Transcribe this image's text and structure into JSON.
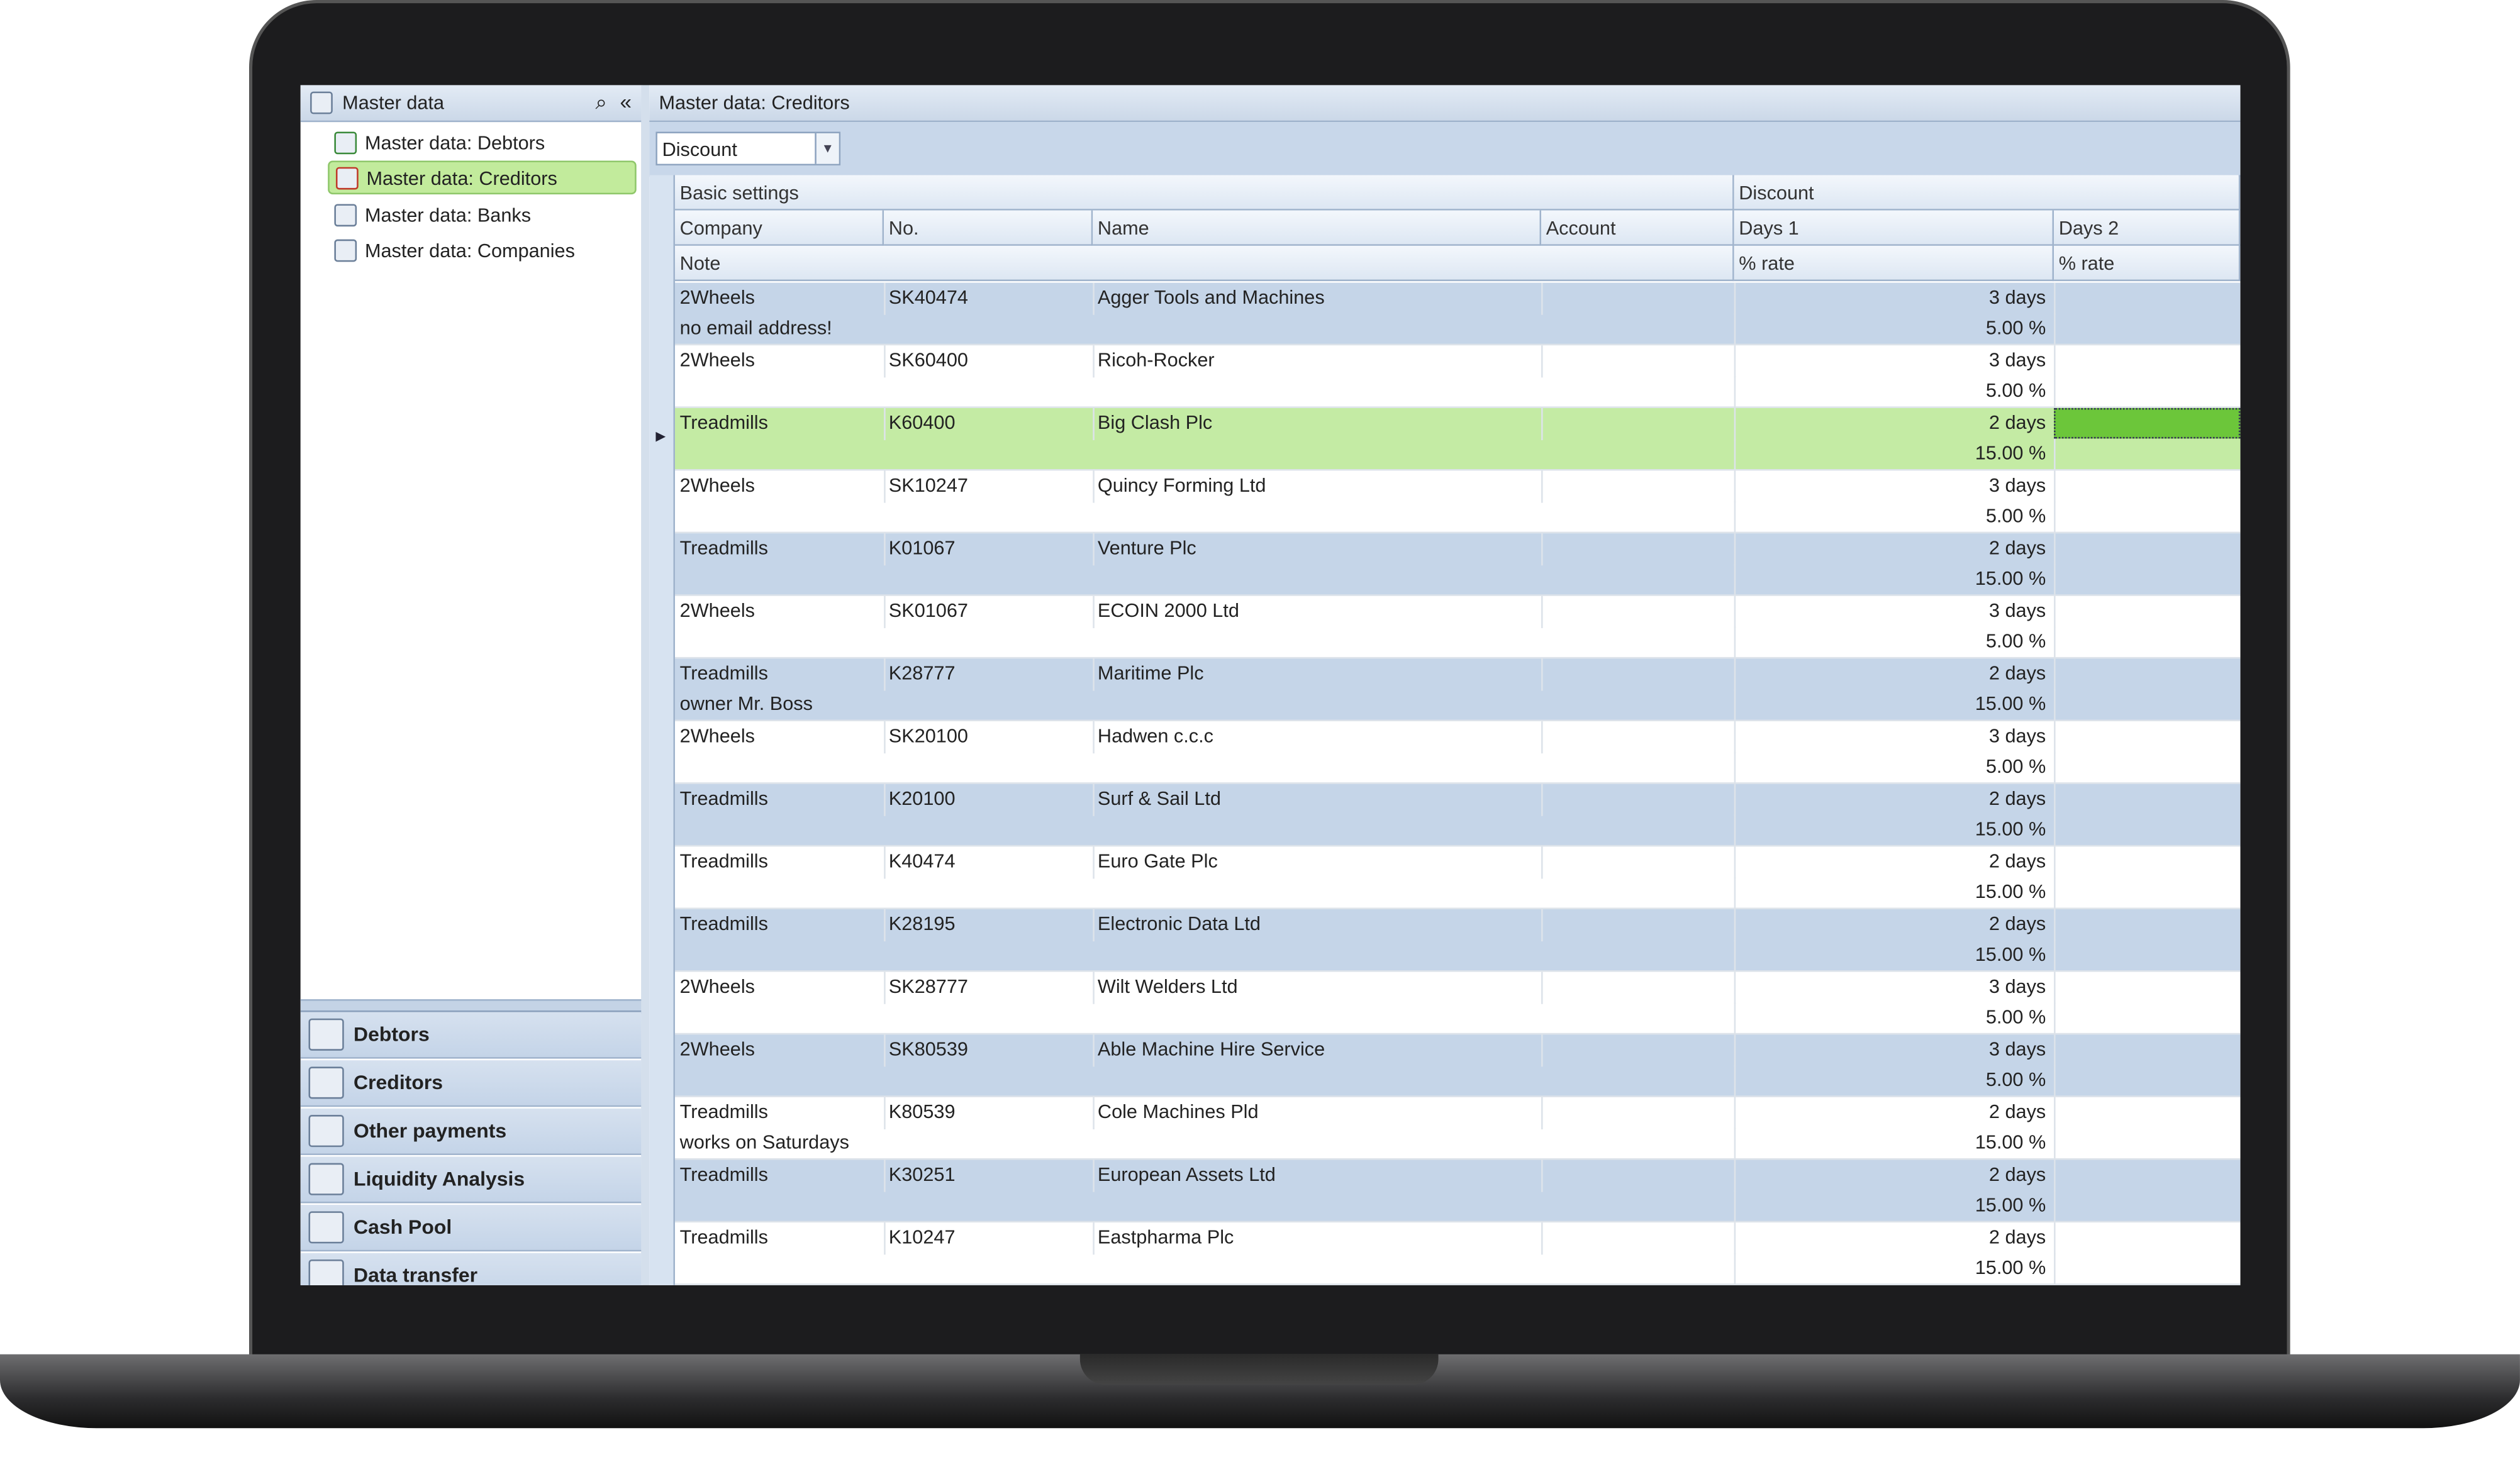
{
  "navigator": {
    "title": "Master data",
    "search_icon": "search-icon",
    "collapse_icon": "double-chevron-left-icon",
    "items": [
      {
        "label": "Master data: Debtors",
        "selected": false
      },
      {
        "label": "Master data: Creditors",
        "selected": true
      },
      {
        "label": "Master data: Banks",
        "selected": false
      },
      {
        "label": "Master data: Companies",
        "selected": false
      }
    ],
    "modules": [
      {
        "label": "Debtors"
      },
      {
        "label": "Creditors"
      },
      {
        "label": "Other payments"
      },
      {
        "label": "Liquidity Analysis"
      },
      {
        "label": "Cash Pool"
      },
      {
        "label": "Data transfer"
      }
    ]
  },
  "main": {
    "title": "Master data: Creditors",
    "view_select": {
      "value": "Discount"
    },
    "bands": {
      "basic": "Basic settings",
      "discount": "Discount"
    },
    "columns": {
      "company": "Company",
      "no": "No.",
      "name": "Name",
      "account": "Account",
      "days1": "Days 1",
      "days2": "Days 2",
      "note": "Note",
      "rate1": "% rate",
      "rate2": "% rate"
    },
    "rows": [
      {
        "company": "2Wheels",
        "no": "SK40474",
        "name": "Agger Tools and Machines",
        "note": "no email address!",
        "days1": "3 days",
        "rate1": "5.00 %"
      },
      {
        "company": "2Wheels",
        "no": "SK60400",
        "name": "Ricoh-Rocker",
        "note": "",
        "days1": "3 days",
        "rate1": "5.00 %"
      },
      {
        "company": "Treadmills",
        "no": "K60400",
        "name": "Big Clash Plc",
        "note": "",
        "days1": "2 days",
        "rate1": "15.00 %",
        "selected": true
      },
      {
        "company": "2Wheels",
        "no": "SK10247",
        "name": "Quincy Forming Ltd",
        "note": "",
        "days1": "3 days",
        "rate1": "5.00 %"
      },
      {
        "company": "Treadmills",
        "no": "K01067",
        "name": "Venture Plc",
        "note": "",
        "days1": "2 days",
        "rate1": "15.00 %"
      },
      {
        "company": "2Wheels",
        "no": "SK01067",
        "name": "ECOIN 2000 Ltd",
        "note": "",
        "days1": "3 days",
        "rate1": "5.00 %"
      },
      {
        "company": "Treadmills",
        "no": "K28777",
        "name": "Maritime Plc",
        "note": "owner Mr. Boss",
        "days1": "2 days",
        "rate1": "15.00 %"
      },
      {
        "company": "2Wheels",
        "no": "SK20100",
        "name": "Hadwen c.c.c",
        "note": "",
        "days1": "3 days",
        "rate1": "5.00 %"
      },
      {
        "company": "Treadmills",
        "no": "K20100",
        "name": "Surf & Sail Ltd",
        "note": "",
        "days1": "2 days",
        "rate1": "15.00 %"
      },
      {
        "company": "Treadmills",
        "no": "K40474",
        "name": "Euro Gate Plc",
        "note": "",
        "days1": "2 days",
        "rate1": "15.00 %"
      },
      {
        "company": "Treadmills",
        "no": "K28195",
        "name": "Electronic Data Ltd",
        "note": "",
        "days1": "2 days",
        "rate1": "15.00 %"
      },
      {
        "company": "2Wheels",
        "no": "SK28777",
        "name": "Wilt Welders Ltd",
        "note": "",
        "days1": "3 days",
        "rate1": "5.00 %"
      },
      {
        "company": "2Wheels",
        "no": "SK80539",
        "name": "Able Machine Hire Service",
        "note": "",
        "days1": "3 days",
        "rate1": "5.00 %"
      },
      {
        "company": "Treadmills",
        "no": "K80539",
        "name": "Cole Machines Pld",
        "note": "works on Saturdays",
        "days1": "2 days",
        "rate1": "15.00 %"
      },
      {
        "company": "Treadmills",
        "no": "K30251",
        "name": "European Assets Ltd",
        "note": "",
        "days1": "2 days",
        "rate1": "15.00 %"
      },
      {
        "company": "Treadmills",
        "no": "K10247",
        "name": "Eastpharma Plc",
        "note": "",
        "days1": "2 days",
        "rate1": "15.00 %"
      }
    ]
  },
  "colors": {
    "selection": "#c4eba4",
    "focus_cell": "#6cc63a",
    "alt_row": "#c5d5e8",
    "header": "#cbd8e8"
  }
}
